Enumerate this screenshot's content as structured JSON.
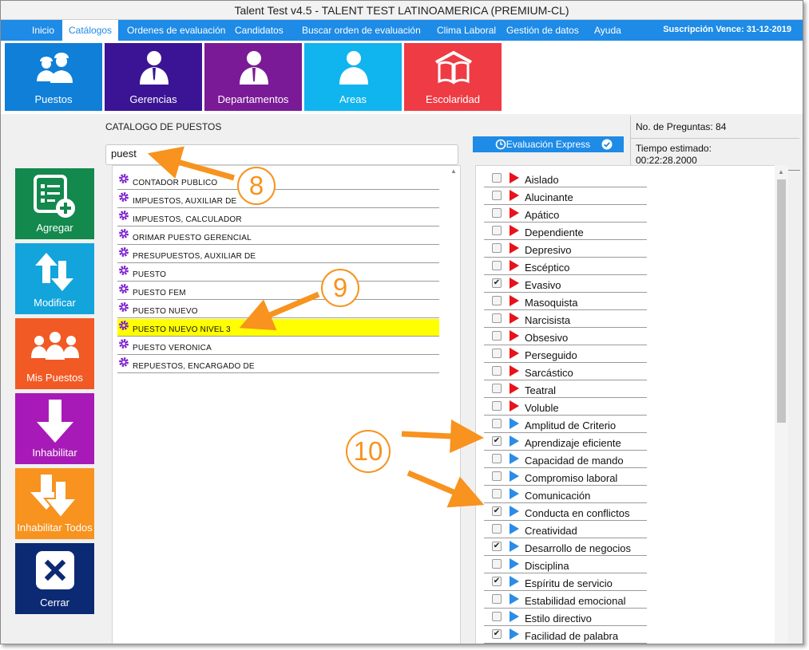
{
  "window": {
    "title": "Talent Test v4.5 - TALENT TEST LATINOAMERICA (PREMIUM-CL)"
  },
  "menu": {
    "items": [
      "Inicio",
      "Catálogos",
      "Ordenes de evaluación",
      "Candidatos",
      "Buscar orden de evaluación",
      "Clima Laboral",
      "Gestión de datos",
      "Ayuda"
    ],
    "active": "Catálogos",
    "subscription": "Suscripción Vence: 31-12-2019"
  },
  "tiles": [
    {
      "label": "Puestos",
      "icon": "workers-icon",
      "color": "#0f7fd8"
    },
    {
      "label": "Gerencias",
      "icon": "manager-icon",
      "color": "#3a1494"
    },
    {
      "label": "Departamentos",
      "icon": "employee-icon",
      "color": "#7a1a96"
    },
    {
      "label": "Areas",
      "icon": "person-icon",
      "color": "#10b4ee"
    },
    {
      "label": "Escolaridad",
      "icon": "book-icon",
      "color": "#ef3b44"
    }
  ],
  "sidebar": [
    {
      "label": "Agregar",
      "icon": "add-list-icon",
      "color": "#13894d"
    },
    {
      "label": "Modificar",
      "icon": "swap-arrows-icon",
      "color": "#12a4db"
    },
    {
      "label": "Mis Puestos",
      "icon": "team-icon",
      "color": "#f15a24"
    },
    {
      "label": "Inhabilitar",
      "icon": "down-arrow-icon",
      "color": "#a81ab8"
    },
    {
      "label": "Inhabilitar Todos",
      "icon": "double-down-arrow-icon",
      "color": "#f7931e"
    },
    {
      "label": "Cerrar",
      "icon": "close-icon",
      "color": "#0c2a73"
    }
  ],
  "catalog": {
    "title": "CATALOGO DE PUESTOS",
    "search_value": "puest",
    "items": [
      "CONTADOR PUBLICO",
      "IMPUESTOS, AUXILIAR DE",
      "IMPUESTOS, CALCULADOR",
      "ORIMAR PUESTO GERENCIAL",
      "PRESUPUESTOS, AUXILIAR DE",
      "PUESTO",
      "PUESTO FEM",
      "PUESTO NUEVO",
      "PUESTO NUEVO NIVEL 3",
      "PUESTO VERONICA",
      "REPUESTOS, ENCARGADO DE"
    ],
    "selected": "PUESTO NUEVO NIVEL 3"
  },
  "express": {
    "label": "Evaluación Express"
  },
  "info": {
    "questions": "No. de Preguntas: 84",
    "time_label": "Tiempo estimado:",
    "time_value": "00:22:28.2000"
  },
  "traits": [
    {
      "label": "Aislado",
      "checked": false,
      "kind": "negative"
    },
    {
      "label": "Alucinante",
      "checked": false,
      "kind": "negative"
    },
    {
      "label": "Apático",
      "checked": false,
      "kind": "negative"
    },
    {
      "label": "Dependiente",
      "checked": false,
      "kind": "negative"
    },
    {
      "label": "Depresivo",
      "checked": false,
      "kind": "negative"
    },
    {
      "label": "Escéptico",
      "checked": false,
      "kind": "negative"
    },
    {
      "label": "Evasivo",
      "checked": true,
      "kind": "negative"
    },
    {
      "label": "Masoquista",
      "checked": false,
      "kind": "negative"
    },
    {
      "label": "Narcisista",
      "checked": false,
      "kind": "negative"
    },
    {
      "label": "Obsesivo",
      "checked": false,
      "kind": "negative"
    },
    {
      "label": "Perseguido",
      "checked": false,
      "kind": "negative"
    },
    {
      "label": "Sarcástico",
      "checked": false,
      "kind": "negative"
    },
    {
      "label": "Teatral",
      "checked": false,
      "kind": "negative"
    },
    {
      "label": "Voluble",
      "checked": false,
      "kind": "negative"
    },
    {
      "label": "Amplitud de Criterio",
      "checked": false,
      "kind": "positive"
    },
    {
      "label": "Aprendizaje eficiente",
      "checked": true,
      "kind": "positive"
    },
    {
      "label": "Capacidad de mando",
      "checked": false,
      "kind": "positive"
    },
    {
      "label": "Compromiso laboral",
      "checked": false,
      "kind": "positive"
    },
    {
      "label": "Comunicación",
      "checked": false,
      "kind": "positive"
    },
    {
      "label": "Conducta en conflictos",
      "checked": true,
      "kind": "positive"
    },
    {
      "label": "Creatividad",
      "checked": false,
      "kind": "positive"
    },
    {
      "label": "Desarrollo de negocios",
      "checked": true,
      "kind": "positive"
    },
    {
      "label": "Disciplina",
      "checked": false,
      "kind": "positive"
    },
    {
      "label": "Espíritu de servicio",
      "checked": true,
      "kind": "positive"
    },
    {
      "label": "Estabilidad emocional",
      "checked": false,
      "kind": "positive"
    },
    {
      "label": "Estilo directivo",
      "checked": false,
      "kind": "positive"
    },
    {
      "label": "Facilidad de palabra",
      "checked": true,
      "kind": "positive"
    }
  ],
  "colors": {
    "accent": "#1e8be6",
    "callout": "#f7931e",
    "negative_flag": "#e8121a",
    "positive_flag": "#2b8ce6",
    "selected_row": "#ffff00"
  },
  "callouts": [
    "8",
    "9",
    "10"
  ]
}
